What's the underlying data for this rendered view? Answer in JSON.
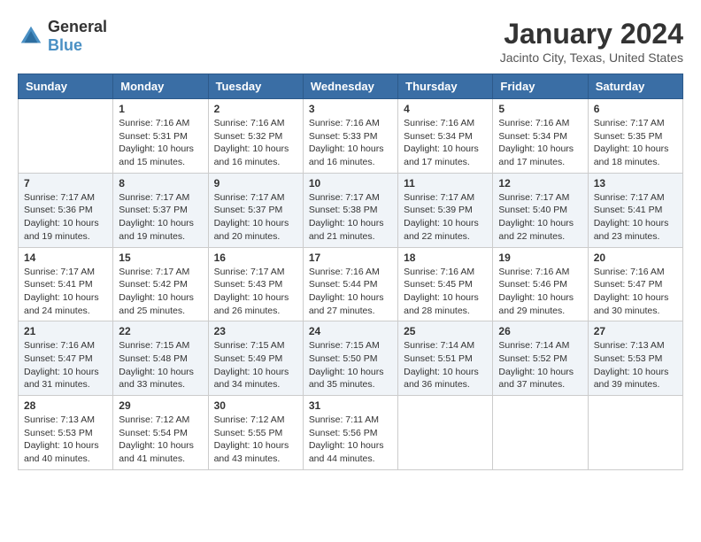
{
  "header": {
    "logo_general": "General",
    "logo_blue": "Blue",
    "title": "January 2024",
    "location": "Jacinto City, Texas, United States"
  },
  "weekdays": [
    "Sunday",
    "Monday",
    "Tuesday",
    "Wednesday",
    "Thursday",
    "Friday",
    "Saturday"
  ],
  "weeks": [
    [
      {
        "day": "",
        "info": ""
      },
      {
        "day": "1",
        "info": "Sunrise: 7:16 AM\nSunset: 5:31 PM\nDaylight: 10 hours\nand 15 minutes."
      },
      {
        "day": "2",
        "info": "Sunrise: 7:16 AM\nSunset: 5:32 PM\nDaylight: 10 hours\nand 16 minutes."
      },
      {
        "day": "3",
        "info": "Sunrise: 7:16 AM\nSunset: 5:33 PM\nDaylight: 10 hours\nand 16 minutes."
      },
      {
        "day": "4",
        "info": "Sunrise: 7:16 AM\nSunset: 5:34 PM\nDaylight: 10 hours\nand 17 minutes."
      },
      {
        "day": "5",
        "info": "Sunrise: 7:16 AM\nSunset: 5:34 PM\nDaylight: 10 hours\nand 17 minutes."
      },
      {
        "day": "6",
        "info": "Sunrise: 7:17 AM\nSunset: 5:35 PM\nDaylight: 10 hours\nand 18 minutes."
      }
    ],
    [
      {
        "day": "7",
        "info": "Sunrise: 7:17 AM\nSunset: 5:36 PM\nDaylight: 10 hours\nand 19 minutes."
      },
      {
        "day": "8",
        "info": "Sunrise: 7:17 AM\nSunset: 5:37 PM\nDaylight: 10 hours\nand 19 minutes."
      },
      {
        "day": "9",
        "info": "Sunrise: 7:17 AM\nSunset: 5:37 PM\nDaylight: 10 hours\nand 20 minutes."
      },
      {
        "day": "10",
        "info": "Sunrise: 7:17 AM\nSunset: 5:38 PM\nDaylight: 10 hours\nand 21 minutes."
      },
      {
        "day": "11",
        "info": "Sunrise: 7:17 AM\nSunset: 5:39 PM\nDaylight: 10 hours\nand 22 minutes."
      },
      {
        "day": "12",
        "info": "Sunrise: 7:17 AM\nSunset: 5:40 PM\nDaylight: 10 hours\nand 22 minutes."
      },
      {
        "day": "13",
        "info": "Sunrise: 7:17 AM\nSunset: 5:41 PM\nDaylight: 10 hours\nand 23 minutes."
      }
    ],
    [
      {
        "day": "14",
        "info": "Sunrise: 7:17 AM\nSunset: 5:41 PM\nDaylight: 10 hours\nand 24 minutes."
      },
      {
        "day": "15",
        "info": "Sunrise: 7:17 AM\nSunset: 5:42 PM\nDaylight: 10 hours\nand 25 minutes."
      },
      {
        "day": "16",
        "info": "Sunrise: 7:17 AM\nSunset: 5:43 PM\nDaylight: 10 hours\nand 26 minutes."
      },
      {
        "day": "17",
        "info": "Sunrise: 7:16 AM\nSunset: 5:44 PM\nDaylight: 10 hours\nand 27 minutes."
      },
      {
        "day": "18",
        "info": "Sunrise: 7:16 AM\nSunset: 5:45 PM\nDaylight: 10 hours\nand 28 minutes."
      },
      {
        "day": "19",
        "info": "Sunrise: 7:16 AM\nSunset: 5:46 PM\nDaylight: 10 hours\nand 29 minutes."
      },
      {
        "day": "20",
        "info": "Sunrise: 7:16 AM\nSunset: 5:47 PM\nDaylight: 10 hours\nand 30 minutes."
      }
    ],
    [
      {
        "day": "21",
        "info": "Sunrise: 7:16 AM\nSunset: 5:47 PM\nDaylight: 10 hours\nand 31 minutes."
      },
      {
        "day": "22",
        "info": "Sunrise: 7:15 AM\nSunset: 5:48 PM\nDaylight: 10 hours\nand 33 minutes."
      },
      {
        "day": "23",
        "info": "Sunrise: 7:15 AM\nSunset: 5:49 PM\nDaylight: 10 hours\nand 34 minutes."
      },
      {
        "day": "24",
        "info": "Sunrise: 7:15 AM\nSunset: 5:50 PM\nDaylight: 10 hours\nand 35 minutes."
      },
      {
        "day": "25",
        "info": "Sunrise: 7:14 AM\nSunset: 5:51 PM\nDaylight: 10 hours\nand 36 minutes."
      },
      {
        "day": "26",
        "info": "Sunrise: 7:14 AM\nSunset: 5:52 PM\nDaylight: 10 hours\nand 37 minutes."
      },
      {
        "day": "27",
        "info": "Sunrise: 7:13 AM\nSunset: 5:53 PM\nDaylight: 10 hours\nand 39 minutes."
      }
    ],
    [
      {
        "day": "28",
        "info": "Sunrise: 7:13 AM\nSunset: 5:53 PM\nDaylight: 10 hours\nand 40 minutes."
      },
      {
        "day": "29",
        "info": "Sunrise: 7:12 AM\nSunset: 5:54 PM\nDaylight: 10 hours\nand 41 minutes."
      },
      {
        "day": "30",
        "info": "Sunrise: 7:12 AM\nSunset: 5:55 PM\nDaylight: 10 hours\nand 43 minutes."
      },
      {
        "day": "31",
        "info": "Sunrise: 7:11 AM\nSunset: 5:56 PM\nDaylight: 10 hours\nand 44 minutes."
      },
      {
        "day": "",
        "info": ""
      },
      {
        "day": "",
        "info": ""
      },
      {
        "day": "",
        "info": ""
      }
    ]
  ]
}
